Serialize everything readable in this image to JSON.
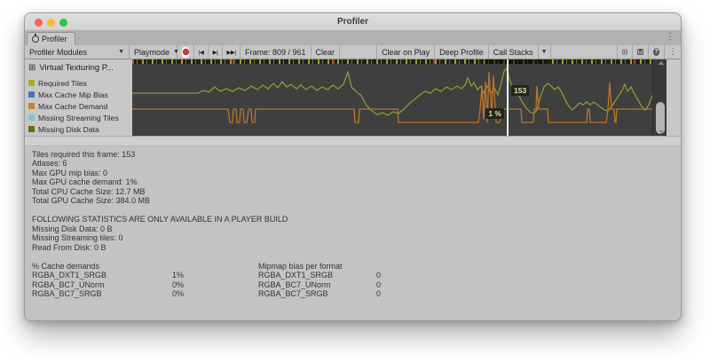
{
  "window": {
    "title": "Profiler"
  },
  "tab": {
    "label": "Profiler"
  },
  "toolbar": {
    "profiler_modules": "Profiler Modules",
    "playmode": "Playmode",
    "prev_frame": "|◀",
    "next_frame": "▶|",
    "current_frame": "▶▶|",
    "frame_counter": "Frame: 809 / 961",
    "clear": "Clear",
    "clear_on_play": "Clear on Play",
    "deep_profile": "Deep Profile",
    "call_stacks": "Call Stacks"
  },
  "module": {
    "header": "Virtual Texturing P...",
    "legend": [
      {
        "label": "Required Tiles",
        "color": "#a2af1f"
      },
      {
        "label": "Max Cache Mip Bias",
        "color": "#4678b2"
      },
      {
        "label": "Max Cache Demand",
        "color": "#d07e2c"
      },
      {
        "label": "Missing Streaming Tiles",
        "color": "#7fc3d4"
      },
      {
        "label": "Missing Disk Data",
        "color": "#6e6914"
      }
    ]
  },
  "chart_data": {
    "type": "line",
    "note": "Unity profiler timeline, selected frame 809 of 961",
    "selected_frame": {
      "tiles_label": "153",
      "percent_label": "1 %"
    },
    "series": [
      {
        "name": "Required Tiles",
        "color": "#8c9a33",
        "points": [
          [
            0,
            38
          ],
          [
            74,
            38
          ],
          [
            80,
            35
          ],
          [
            86,
            37
          ],
          [
            93,
            31
          ],
          [
            99,
            36
          ],
          [
            106,
            33
          ],
          [
            113,
            36
          ],
          [
            120,
            32
          ],
          [
            127,
            35
          ],
          [
            134,
            30
          ],
          [
            141,
            34
          ],
          [
            147,
            29
          ],
          [
            153,
            33
          ],
          [
            159,
            27
          ],
          [
            164,
            32
          ],
          [
            169,
            25
          ],
          [
            174,
            31
          ],
          [
            179,
            28
          ],
          [
            185,
            33
          ],
          [
            190,
            29
          ],
          [
            196,
            34
          ],
          [
            202,
            30
          ],
          [
            208,
            35
          ],
          [
            214,
            31
          ],
          [
            220,
            34
          ],
          [
            226,
            29
          ],
          [
            232,
            33
          ],
          [
            238,
            28
          ],
          [
            243,
            14
          ],
          [
            247,
            31
          ],
          [
            252,
            36
          ],
          [
            258,
            41
          ],
          [
            264,
            52
          ],
          [
            270,
            58
          ],
          [
            276,
            62
          ],
          [
            282,
            60
          ],
          [
            288,
            63
          ],
          [
            294,
            59
          ],
          [
            300,
            61
          ],
          [
            306,
            56
          ],
          [
            312,
            50
          ],
          [
            318,
            45
          ],
          [
            324,
            40
          ],
          [
            330,
            36
          ],
          [
            336,
            38
          ],
          [
            342,
            33
          ],
          [
            348,
            36
          ],
          [
            354,
            31
          ],
          [
            360,
            34
          ],
          [
            366,
            30
          ],
          [
            371,
            33
          ],
          [
            375,
            29
          ],
          [
            378,
            21
          ],
          [
            382,
            30
          ],
          [
            385,
            26
          ],
          [
            389,
            34
          ],
          [
            393,
            30
          ],
          [
            396,
            38
          ],
          [
            400,
            30
          ],
          [
            404,
            38
          ],
          [
            408,
            32
          ],
          [
            412,
            40
          ],
          [
            416,
            26
          ],
          [
            419,
            13
          ],
          [
            422,
            10
          ],
          [
            425,
            22
          ],
          [
            428,
            31
          ],
          [
            432,
            36
          ],
          [
            436,
            41
          ],
          [
            440,
            49
          ],
          [
            444,
            55
          ],
          [
            448,
            59
          ],
          [
            452,
            61
          ],
          [
            456,
            57
          ],
          [
            460,
            42
          ],
          [
            464,
            31
          ],
          [
            468,
            27
          ],
          [
            472,
            30
          ],
          [
            476,
            34
          ],
          [
            480,
            31
          ],
          [
            484,
            37
          ],
          [
            488,
            46
          ],
          [
            492,
            53
          ],
          [
            496,
            57
          ],
          [
            500,
            53
          ],
          [
            504,
            49
          ],
          [
            508,
            51
          ],
          [
            512,
            48
          ],
          [
            516,
            51
          ],
          [
            520,
            48
          ],
          [
            524,
            51
          ],
          [
            528,
            54
          ],
          [
            532,
            57
          ],
          [
            536,
            58
          ],
          [
            540,
            53
          ],
          [
            544,
            47
          ],
          [
            548,
            41
          ],
          [
            552,
            35
          ],
          [
            555,
            28
          ],
          [
            558,
            36
          ],
          [
            562,
            31
          ],
          [
            566,
            39
          ],
          [
            570,
            46
          ],
          [
            574,
            53
          ],
          [
            578,
            57
          ],
          [
            582,
            51
          ],
          [
            586,
            41
          ],
          [
            590,
            31
          ],
          [
            594,
            25
          ],
          [
            597,
            22
          ],
          [
            600,
            27
          ],
          [
            602,
            33
          ]
        ]
      },
      {
        "name": "Max Cache Demand",
        "color": "#ba752a",
        "points": [
          [
            0,
            56
          ],
          [
            108,
            56
          ],
          [
            110,
            71
          ],
          [
            113,
            71
          ],
          [
            114,
            56
          ],
          [
            117,
            56
          ],
          [
            118,
            71
          ],
          [
            121,
            71
          ],
          [
            122,
            56
          ],
          [
            125,
            56
          ],
          [
            126,
            71
          ],
          [
            129,
            71
          ],
          [
            131,
            56
          ],
          [
            134,
            56
          ],
          [
            135,
            71
          ],
          [
            138,
            71
          ],
          [
            139,
            56
          ],
          [
            250,
            56
          ],
          [
            251,
            71
          ],
          [
            255,
            71
          ],
          [
            256,
            56
          ],
          [
            299,
            56
          ],
          [
            300,
            71
          ],
          [
            390,
            71
          ],
          [
            392,
            56
          ],
          [
            394,
            30
          ],
          [
            396,
            68
          ],
          [
            398,
            25
          ],
          [
            400,
            71
          ],
          [
            402,
            14
          ],
          [
            405,
            62
          ],
          [
            407,
            18
          ],
          [
            410,
            71
          ],
          [
            414,
            71
          ],
          [
            418,
            56
          ],
          [
            438,
            56
          ],
          [
            439,
            71
          ],
          [
            452,
            71
          ],
          [
            453,
            56
          ],
          [
            455,
            56
          ],
          [
            456,
            30
          ],
          [
            458,
            56
          ],
          [
            468,
            56
          ],
          [
            469,
            71
          ],
          [
            512,
            71
          ],
          [
            513,
            56
          ],
          [
            515,
            56
          ],
          [
            516,
            71
          ],
          [
            534,
            71
          ],
          [
            536,
            56
          ],
          [
            538,
            26
          ],
          [
            540,
            56
          ],
          [
            543,
            56
          ],
          [
            544,
            71
          ],
          [
            545,
            71
          ],
          [
            546,
            56
          ],
          [
            602,
            56
          ]
        ]
      }
    ]
  },
  "stats": {
    "frame_block": [
      "Tiles required this frame: 153",
      "Atlases: 6",
      "Max GPU mip bias: 0",
      "Max GPU cache demand: 1%",
      "Total CPU Cache Size: 12.7 MB",
      "Total GPU Cache Size: 384.0 MB"
    ],
    "player_build_block": [
      "FOLLOWING STATISTICS ARE ONLY AVAILABLE IN A PLAYER BUILD",
      "Missing Disk Data: 0 B",
      "Missing Streaming tiles: 0",
      "Read From Disk: 0 B"
    ],
    "cache_demands": {
      "title": "% Cache demands",
      "rows": [
        [
          "RGBA_DXT1_SRGB",
          "1%"
        ],
        [
          "RGBA_BC7_UNorm",
          "0%"
        ],
        [
          "RGBA_BC7_SRGB",
          "0%"
        ]
      ]
    },
    "mipmap_bias": {
      "title": "Mipmap bias per format",
      "rows": [
        [
          "RGBA_DXT1_SRGB",
          "0"
        ],
        [
          "RGBA_BC7_UNorm",
          "0"
        ],
        [
          "RGBA_BC7_SRGB",
          "0"
        ]
      ]
    }
  }
}
